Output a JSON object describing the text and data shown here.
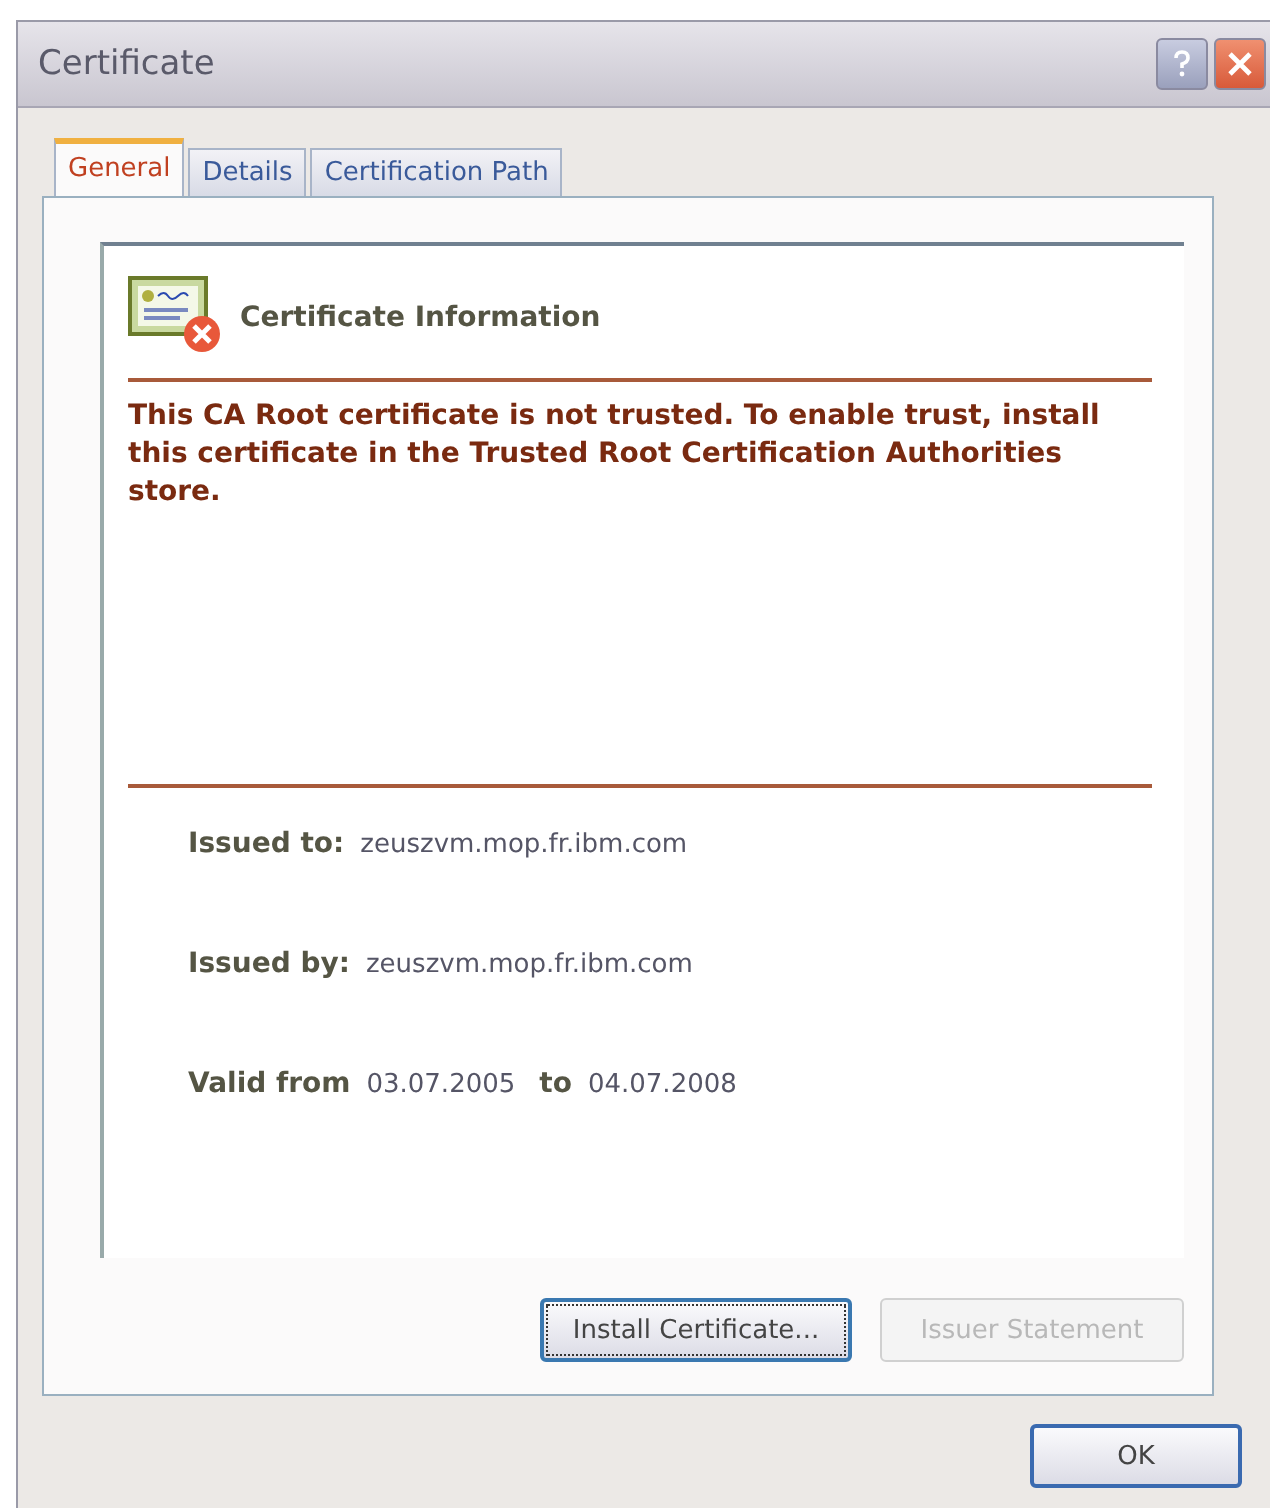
{
  "window": {
    "title": "Certificate"
  },
  "tabs": [
    {
      "label": "General",
      "selected": true
    },
    {
      "label": "Details",
      "selected": false
    },
    {
      "label": "Certification Path",
      "selected": false
    }
  ],
  "info": {
    "heading": "Certificate Information",
    "message": "This CA Root certificate is not trusted. To enable trust, install this certificate in the Trusted Root Certification Authorities store.",
    "issued_to": {
      "label": "Issued to:",
      "value": "zeuszvm.mop.fr.ibm.com"
    },
    "issued_by": {
      "label": "Issued by:",
      "value": "zeuszvm.mop.fr.ibm.com"
    },
    "valid": {
      "from_label": "Valid from",
      "from": "03.07.2005",
      "to_label": "to",
      "to": "04.07.2008"
    }
  },
  "panel_buttons": [
    {
      "label": "Install Certificate...",
      "disabled": false
    },
    {
      "label": "Issuer Statement",
      "disabled": true
    }
  ],
  "buttons": [
    "OK"
  ]
}
